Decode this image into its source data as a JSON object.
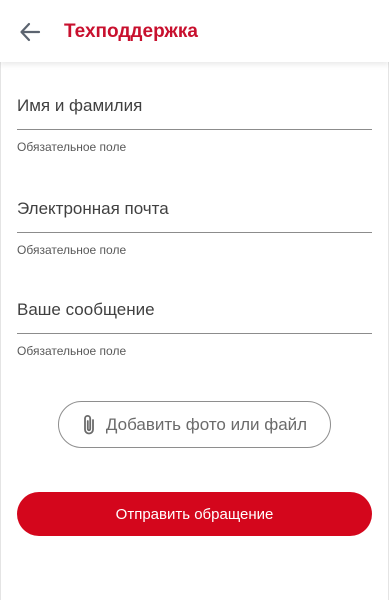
{
  "header": {
    "title": "Техподдержка",
    "back_icon": "arrow-left-icon"
  },
  "form": {
    "fields": [
      {
        "placeholder": "Имя и фамилия",
        "value": "",
        "hint": "Обязательное поле"
      },
      {
        "placeholder": "Электронная почта",
        "value": "",
        "hint": "Обязательное поле"
      },
      {
        "placeholder": "Ваше сообщение",
        "value": "",
        "hint": "Обязательное поле"
      }
    ],
    "attach_button": {
      "label": "Добавить фото или файл",
      "icon": "paperclip-icon"
    },
    "submit_button": {
      "label": "Отправить обращение"
    }
  },
  "colors": {
    "accent": "#d4061c",
    "title": "#c8102e",
    "icon": "#5c6470",
    "underline": "#8c8c8c"
  }
}
